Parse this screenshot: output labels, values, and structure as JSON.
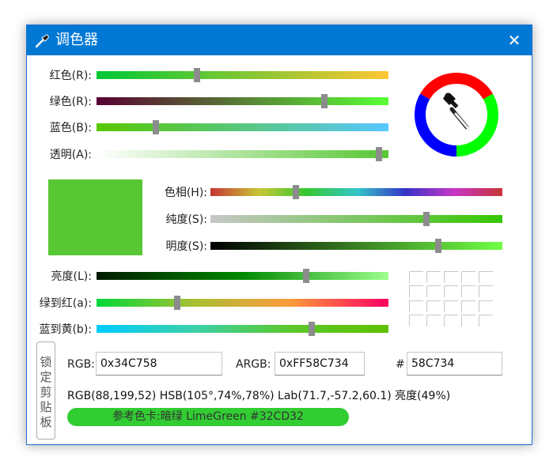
{
  "title": "调色器",
  "colors": {
    "titlebar": "#0078d4",
    "current": "#58C734",
    "thumb": "#8c8c8c",
    "reference": "#32CD32"
  },
  "icons": {
    "title": "eyedropper-icon",
    "close": "close-icon",
    "wheel_center": "eyedropper-icon"
  },
  "close_glyph": "✕",
  "sliders_top": [
    {
      "label": "红色(R):",
      "value": 88,
      "max": 255
    },
    {
      "label": "绿色(R):",
      "value": 199,
      "max": 255
    },
    {
      "label": "蓝色(B):",
      "value": 52,
      "max": 255
    },
    {
      "label": "透明(A):",
      "value": 247,
      "max": 255
    }
  ],
  "sliders_hsb": [
    {
      "label": "色相(H):",
      "value": 105,
      "max": 360
    },
    {
      "label": "纯度(S):",
      "value": 74,
      "max": 100
    },
    {
      "label": "明度(S):",
      "value": 78,
      "max": 100
    }
  ],
  "sliders_lab": [
    {
      "label": "亮度(L):",
      "value": 71.7,
      "min": 0,
      "max": 100
    },
    {
      "label": "绿到红(a):",
      "value": -57.2,
      "min": -128,
      "max": 127
    },
    {
      "label": "蓝到黄(b):",
      "value": 60.1,
      "min": -128,
      "max": 127
    }
  ],
  "lock_button": "锁定剪贴板",
  "fields": {
    "rgb_label": "RGB:",
    "rgb_value": "0x34C758",
    "argb_label": "ARGB:",
    "argb_value": "0xFF58C734",
    "hex_label": "#",
    "hex_value": "58C734"
  },
  "info_line": "RGB(88,199,52) HSB(105°,74%,78%) Lab(71.7,-57.2,60.1) 亮度(49%)",
  "reference_text": "参考色卡:暗绿 LimeGreen  #32CD32"
}
